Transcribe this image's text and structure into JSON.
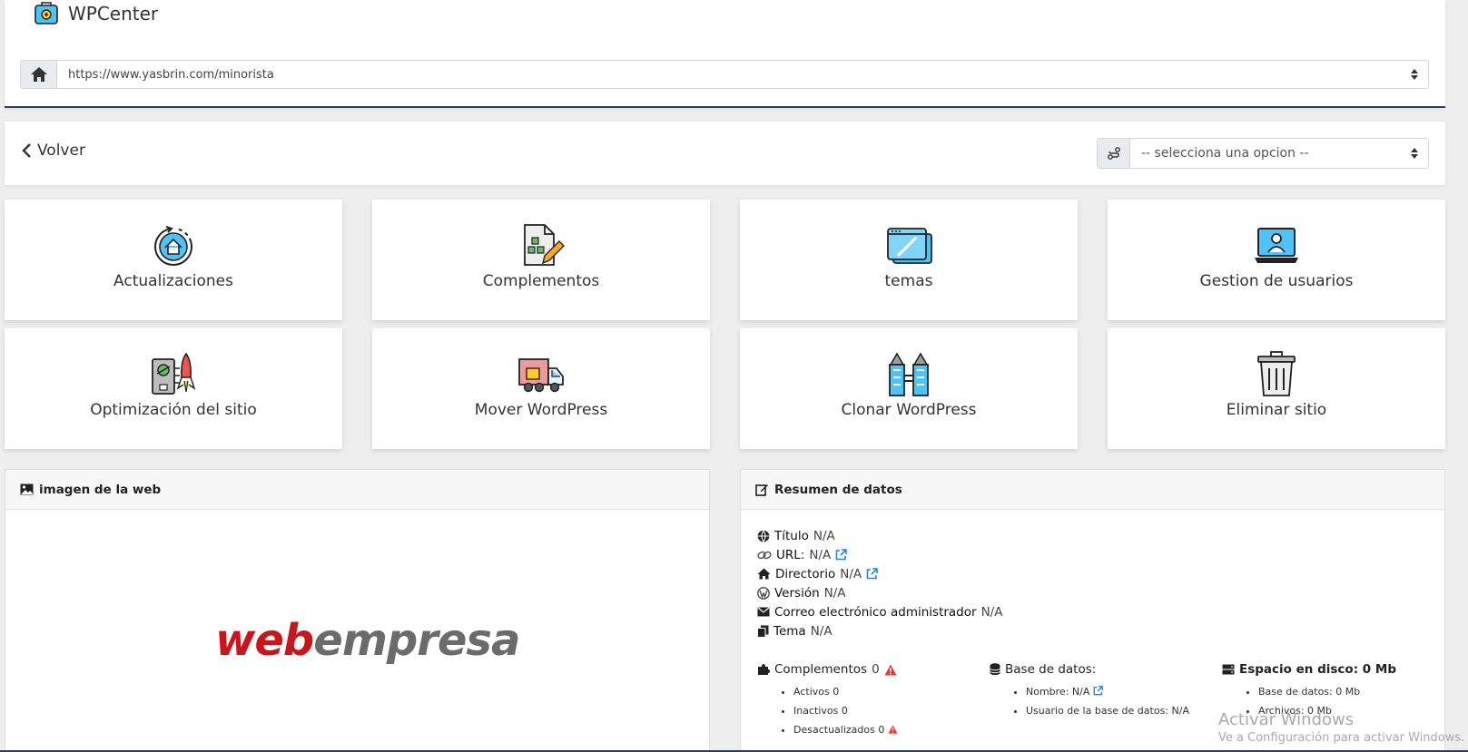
{
  "app": {
    "name": "WPCenter"
  },
  "url_bar": {
    "value": "https://www.yasbrin.com/minorista"
  },
  "toolbar": {
    "back_label": "Volver",
    "select_placeholder": "-- selecciona una opcion --"
  },
  "tiles": [
    {
      "label": "Actualizaciones",
      "icon": "update-icon"
    },
    {
      "label": "Complementos",
      "icon": "plugins-icon"
    },
    {
      "label": "temas",
      "icon": "themes-icon"
    },
    {
      "label": "Gestion de usuarios",
      "icon": "users-icon"
    },
    {
      "label": "Optimización del sitio",
      "icon": "optimization-icon"
    },
    {
      "label": "Mover WordPress",
      "icon": "truck-icon"
    },
    {
      "label": "Clonar WordPress",
      "icon": "clone-icon"
    },
    {
      "label": "Eliminar sitio",
      "icon": "trash-icon"
    }
  ],
  "image_panel": {
    "title": "imagen de la web",
    "logo_part1": "web",
    "logo_part2": "empresa"
  },
  "summary": {
    "title": "Resumen de datos",
    "facts": [
      {
        "label": "Título",
        "value": "N/A"
      },
      {
        "label": "URL:",
        "value": "N/A"
      },
      {
        "label": "Directorio",
        "value": "N/A"
      },
      {
        "label": "Versión",
        "value": "N/A"
      },
      {
        "label": "Correo electrónico administrador",
        "value": "N/A"
      },
      {
        "label": "Tema",
        "value": "N/A"
      }
    ],
    "plugins": {
      "label": "Complementos",
      "count": "0",
      "items": [
        "Activos 0",
        "Inactivos 0",
        "Desactualizados 0"
      ]
    },
    "database": {
      "label": "Base de datos:",
      "items": [
        "Nombre: N/A",
        "Usuario de la base de datos: N/A"
      ]
    },
    "disk": {
      "label": "Espacio en disco: 0 Mb",
      "items": [
        "Base de datos: 0 Mb",
        "Archivos: 0 Mb"
      ]
    }
  },
  "watermark": {
    "line1": "Activar Windows",
    "line2": "Ve a Configuración para activar Windows."
  },
  "colors": {
    "accent_blue": "#1e88e5",
    "warning_red": "#e53935",
    "navy": "#2c3e5a"
  }
}
